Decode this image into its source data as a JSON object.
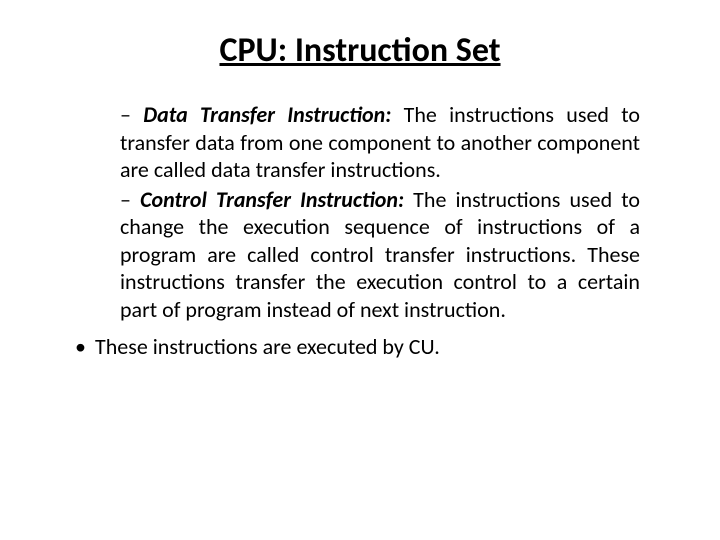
{
  "title": "CPU: Instruction Set",
  "items": [
    {
      "heading": "Data Transfer Instruction:",
      "body": " The instructions used to transfer data from one component to another component are called data transfer instructions."
    },
    {
      "heading": "Control Transfer Instruction:",
      "body": " The instructions used to change the execution sequence of instructions of a program are called control transfer instructions. These instructions transfer the execution control to a certain part of program instead of next instruction."
    }
  ],
  "footer": "These instructions are executed by CU."
}
